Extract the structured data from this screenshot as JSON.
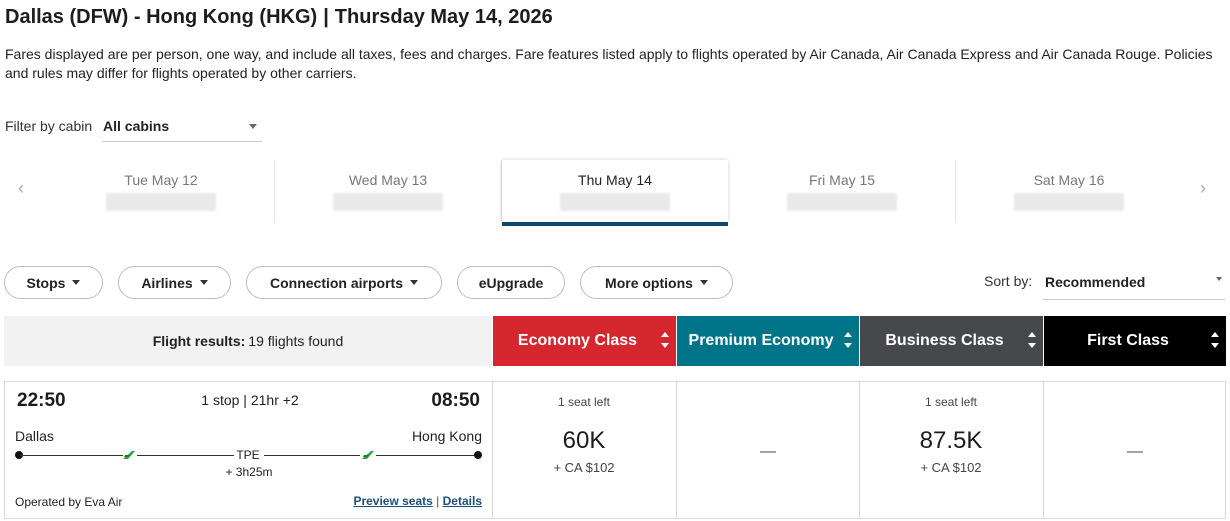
{
  "header": {
    "route": "Dallas (DFW) - Hong Kong (HKG)",
    "separator": "|",
    "date": "Thursday May 14, 2026",
    "disclaimer": "Fares displayed are per person, one way, and include all taxes, fees and charges. Fare features listed apply to flights operated by Air Canada, Air Canada Express and Air Canada Rouge. Policies and rules may differ for flights operated by other carriers."
  },
  "filter": {
    "label": "Filter by cabin",
    "value": "All cabins"
  },
  "dates": [
    {
      "label": "Tue May 12",
      "selected": false
    },
    {
      "label": "Wed May 13",
      "selected": false
    },
    {
      "label": "Thu May 14",
      "selected": true
    },
    {
      "label": "Fri May 15",
      "selected": false
    },
    {
      "label": "Sat May 16",
      "selected": false
    }
  ],
  "pills": {
    "stops": "Stops",
    "airlines": "Airlines",
    "connection": "Connection airports",
    "eupgrade": "eUpgrade",
    "more": "More options"
  },
  "sort": {
    "label": "Sort by:",
    "value": "Recommended"
  },
  "results": {
    "label": "Flight results:",
    "count": "19 flights found"
  },
  "cabins": [
    {
      "name": "Economy Class",
      "color": "#d6262e"
    },
    {
      "name": "Premium Economy",
      "color": "#00758a"
    },
    {
      "name": "Business Class",
      "color": "#46484b"
    },
    {
      "name": "First Class",
      "color": "#000000"
    }
  ],
  "flight": {
    "depart_time": "22:50",
    "arrive_time": "08:50",
    "summary": "1 stop | 21hr +2",
    "origin": "Dallas",
    "destination": "Hong Kong",
    "stop_code": "TPE",
    "layover": "+ 3h25m",
    "operator": "Operated by Eva Air",
    "preview_seats": "Preview seats",
    "link_sep": "|",
    "details": "Details",
    "fares": {
      "economy": {
        "seats": "1 seat left",
        "points": "60K",
        "cash": "+ CA $102"
      },
      "premium": {
        "dash": "—"
      },
      "business": {
        "seats": "1 seat left",
        "points": "87.5K",
        "cash": "+ CA $102"
      },
      "first": {
        "dash": "—"
      }
    }
  }
}
